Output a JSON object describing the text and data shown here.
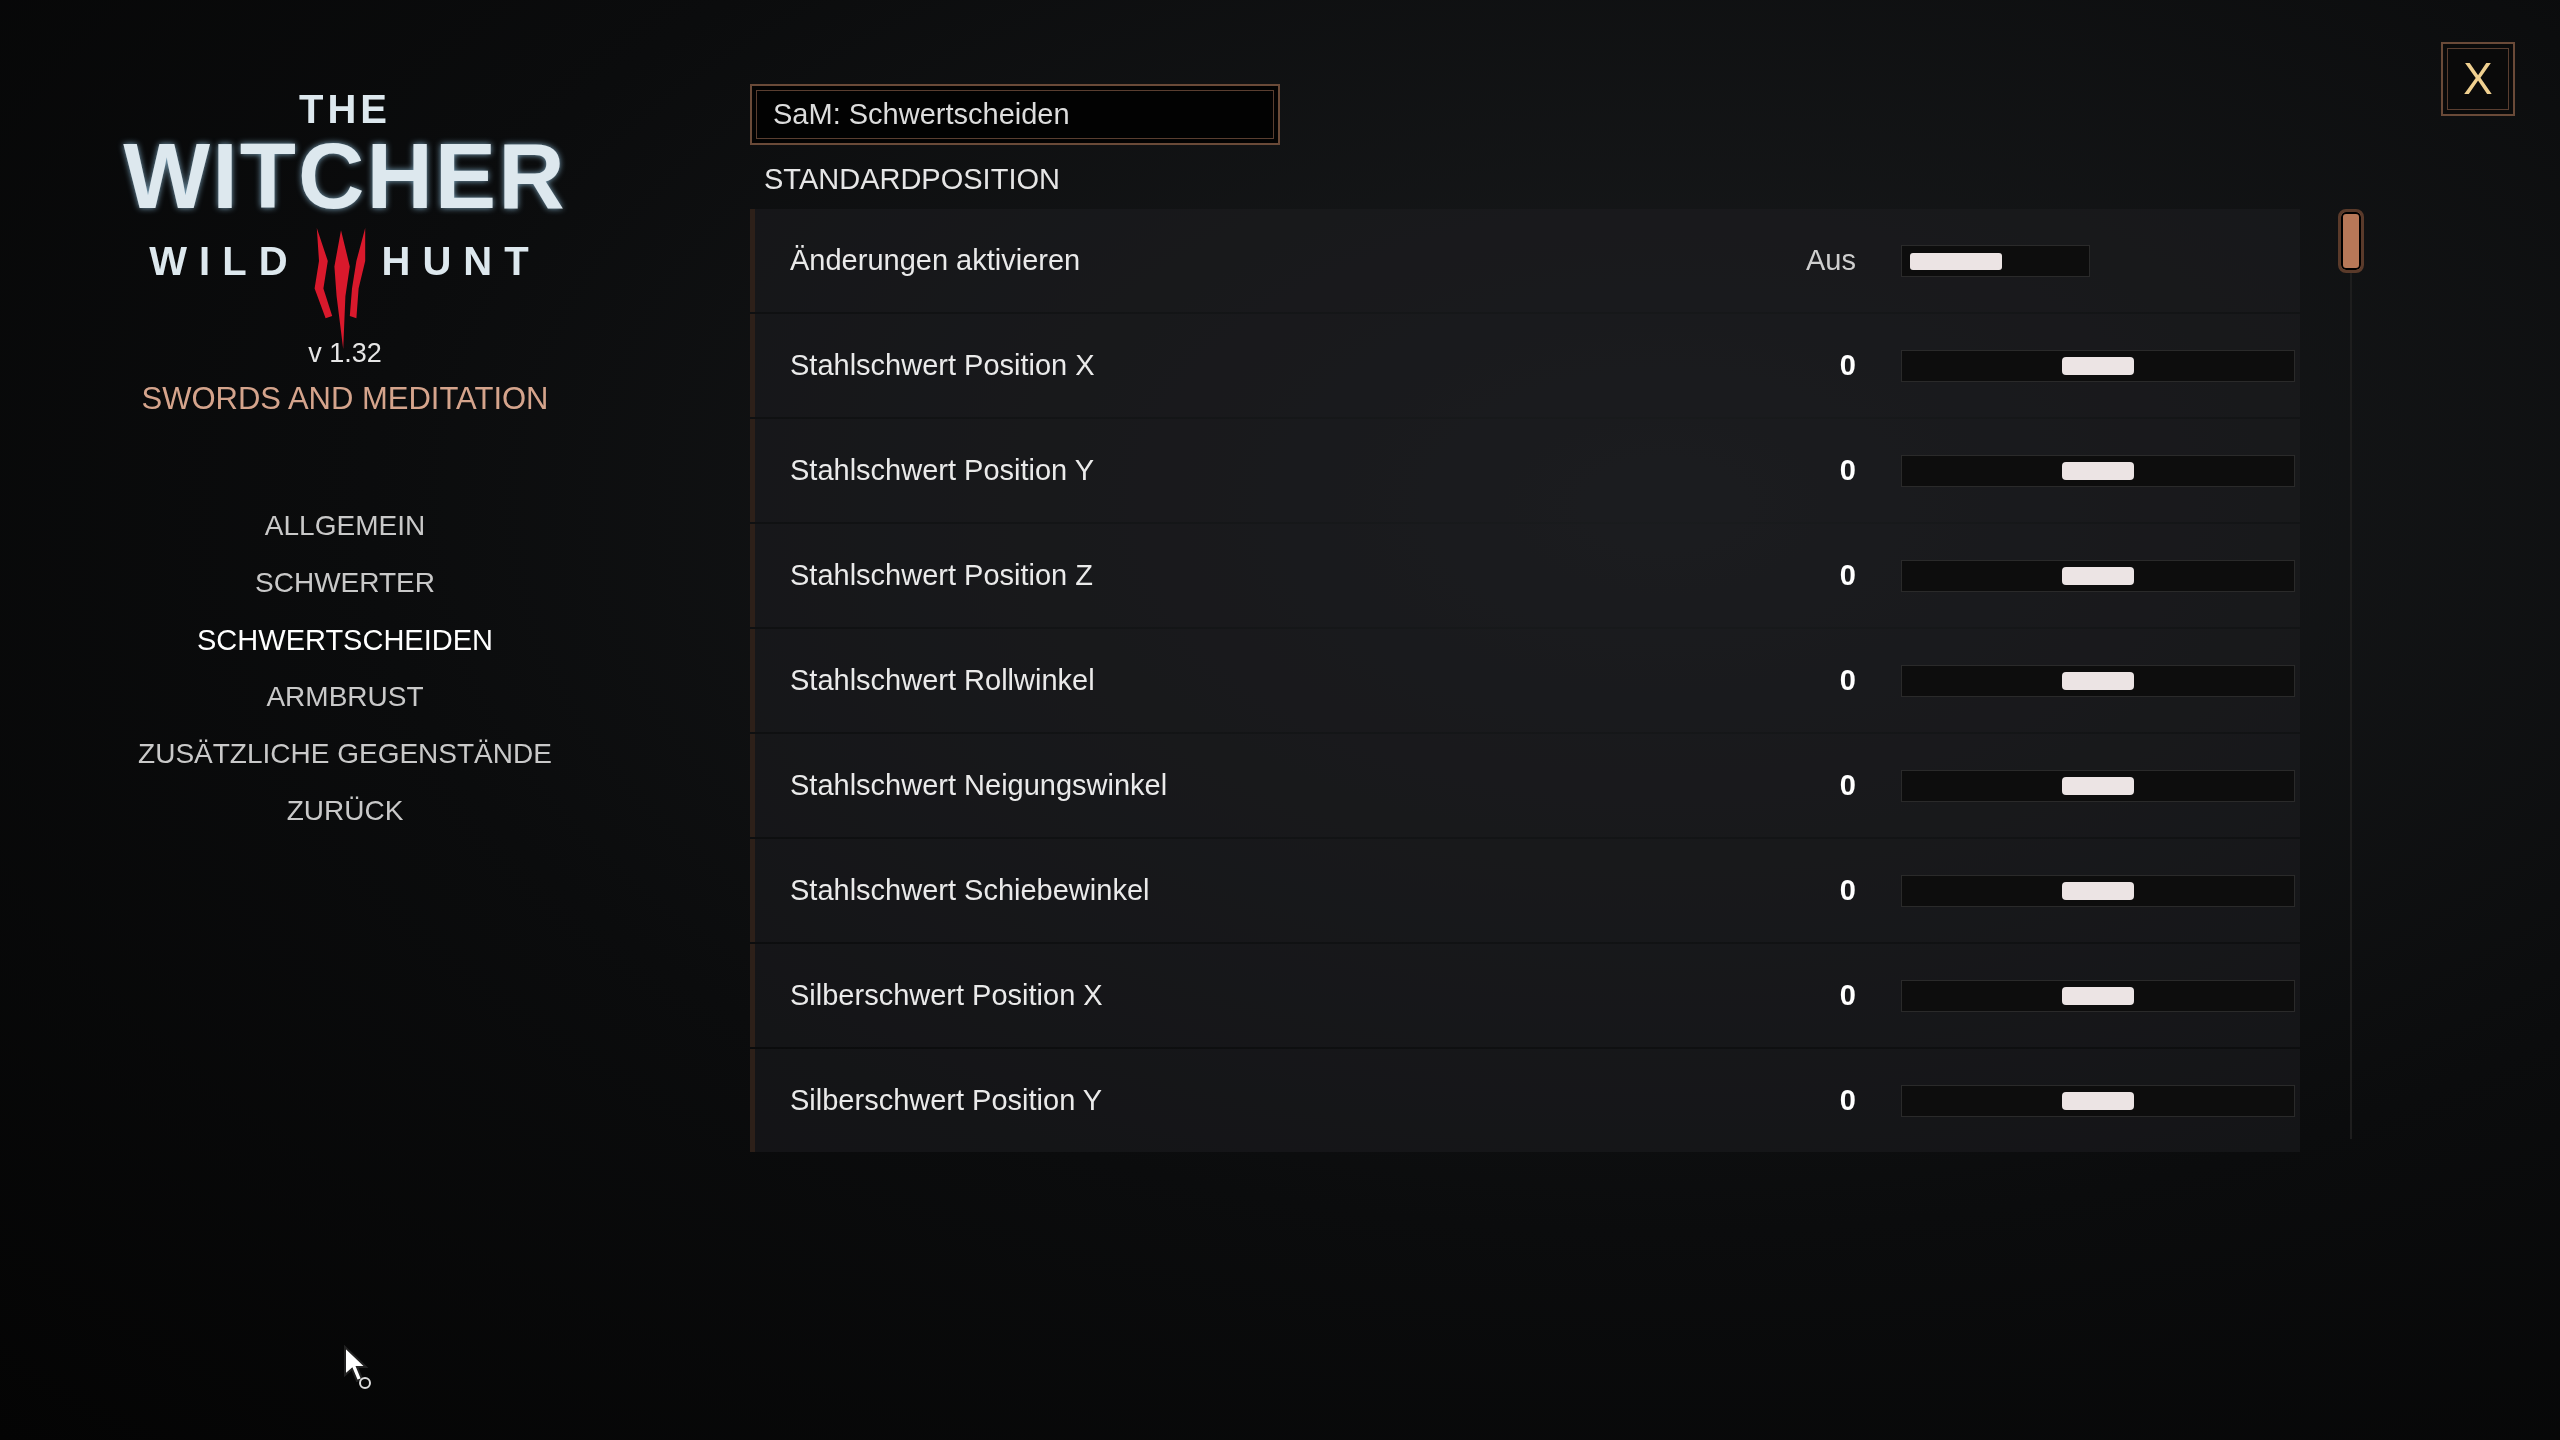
{
  "logo": {
    "top": "THE",
    "main": "WITCHER",
    "left": "WILD",
    "right": "HUNT"
  },
  "version": "v 1.32",
  "mod_title": "SWORDS AND MEDITATION",
  "menu": [
    {
      "label": "ALLGEMEIN",
      "selected": false
    },
    {
      "label": "SCHWERTER",
      "selected": false
    },
    {
      "label": "SCHWERTSCHEIDEN",
      "selected": true
    },
    {
      "label": "ARMBRUST",
      "selected": false
    },
    {
      "label": "ZUSÄTZLICHE GEGENSTÄNDE",
      "selected": false
    },
    {
      "label": "ZURÜCK",
      "selected": false
    }
  ],
  "page_title": "SaM: Schwertscheiden",
  "section": "STANDARDPOSITION",
  "rows": [
    {
      "kind": "toggle",
      "label": "Änderungen aktivieren",
      "value": "Aus",
      "on": false
    },
    {
      "kind": "slider",
      "label": "Stahlschwert Position X",
      "value": "0",
      "level": 0.5
    },
    {
      "kind": "slider",
      "label": "Stahlschwert Position Y",
      "value": "0",
      "level": 0.5
    },
    {
      "kind": "slider",
      "label": "Stahlschwert Position Z",
      "value": "0",
      "level": 0.5
    },
    {
      "kind": "slider",
      "label": "Stahlschwert Rollwinkel",
      "value": "0",
      "level": 0.5
    },
    {
      "kind": "slider",
      "label": "Stahlschwert Neigungswinkel",
      "value": "0",
      "level": 0.5
    },
    {
      "kind": "slider",
      "label": "Stahlschwert Schiebewinkel",
      "value": "0",
      "level": 0.5
    },
    {
      "kind": "slider",
      "label": "Silberschwert Position X",
      "value": "0",
      "level": 0.5
    },
    {
      "kind": "slider",
      "label": "Silberschwert Position Y",
      "value": "0",
      "level": 0.5
    }
  ],
  "close_label": "X"
}
